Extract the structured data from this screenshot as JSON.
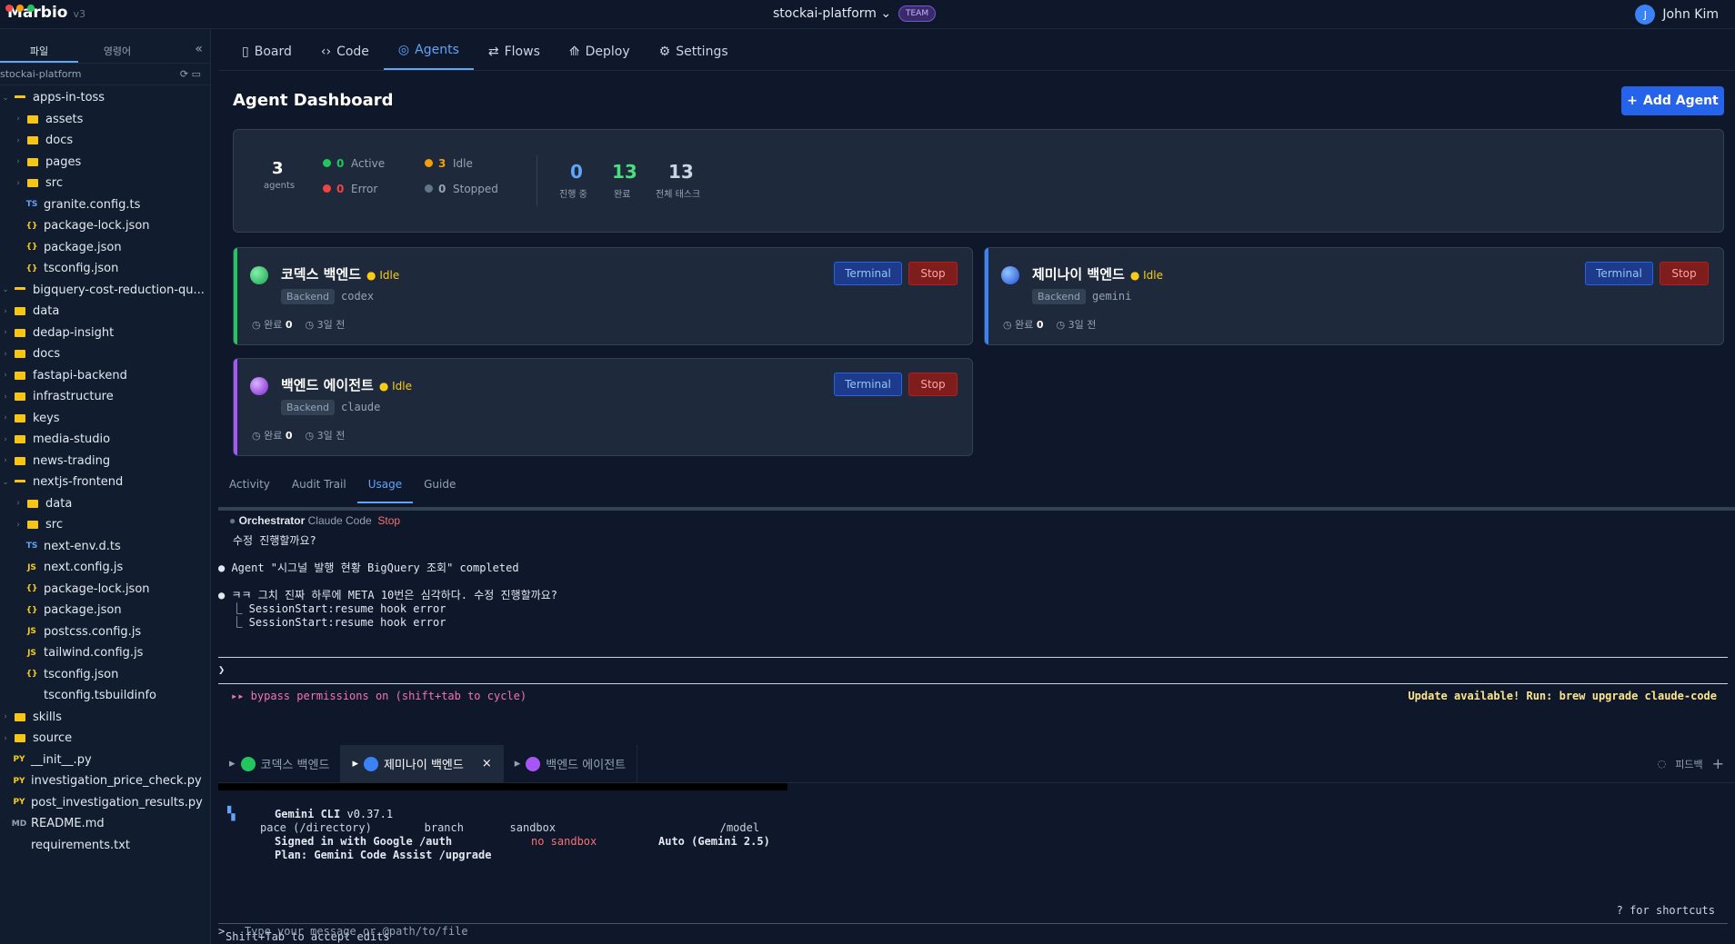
{
  "app": {
    "name": "Marbio",
    "version": "v3",
    "project": "stockai-platform",
    "team_badge": "TEAM",
    "user_initial": "J",
    "user_name": "John Kim"
  },
  "sidebar": {
    "tab_files": "파일",
    "tab_en": "영령어",
    "path": "stockai-platform",
    "tree": [
      {
        "label": "apps-in-toss",
        "type": "open"
      },
      {
        "label": "assets",
        "type": "folder",
        "indent": 1
      },
      {
        "label": "docs",
        "type": "folder",
        "indent": 1
      },
      {
        "label": "pages",
        "type": "folder",
        "indent": 1
      },
      {
        "label": "src",
        "type": "folder",
        "indent": 1
      },
      {
        "label": "granite.config.ts",
        "type": "TS",
        "indent": 1
      },
      {
        "label": "package-lock.json",
        "type": "{}",
        "indent": 1
      },
      {
        "label": "package.json",
        "type": "{}",
        "indent": 1
      },
      {
        "label": "tsconfig.json",
        "type": "{}",
        "indent": 1
      },
      {
        "label": "bigquery-cost-reduction-qu...",
        "type": "open"
      },
      {
        "label": "data",
        "type": "folder"
      },
      {
        "label": "dedap-insight",
        "type": "folder"
      },
      {
        "label": "docs",
        "type": "folder"
      },
      {
        "label": "fastapi-backend",
        "type": "folder"
      },
      {
        "label": "infrastructure",
        "type": "folder"
      },
      {
        "label": "keys",
        "type": "folder"
      },
      {
        "label": "media-studio",
        "type": "folder"
      },
      {
        "label": "news-trading",
        "type": "folder"
      },
      {
        "label": "nextjs-frontend",
        "type": "open"
      },
      {
        "label": "data",
        "type": "folder",
        "indent": 1
      },
      {
        "label": "src",
        "type": "folder",
        "indent": 1
      },
      {
        "label": "next-env.d.ts",
        "type": "TS",
        "indent": 1
      },
      {
        "label": "next.config.js",
        "type": "JS",
        "indent": 1
      },
      {
        "label": "package-lock.json",
        "type": "{}",
        "indent": 1
      },
      {
        "label": "package.json",
        "type": "{}",
        "indent": 1
      },
      {
        "label": "postcss.config.js",
        "type": "JS",
        "indent": 1
      },
      {
        "label": "tailwind.config.js",
        "type": "JS",
        "indent": 1
      },
      {
        "label": "tsconfig.json",
        "type": "{}",
        "indent": 1
      },
      {
        "label": "tsconfig.tsbuildinfo",
        "type": "",
        "indent": 1
      },
      {
        "label": "skills",
        "type": "folder"
      },
      {
        "label": "source",
        "type": "folder"
      },
      {
        "label": "__init__.py",
        "type": "PY"
      },
      {
        "label": "investigation_price_check.py",
        "type": "PY"
      },
      {
        "label": "post_investigation_results.py",
        "type": "PY"
      },
      {
        "label": "README.md",
        "type": "MD"
      },
      {
        "label": "requirements.txt",
        "type": ""
      }
    ]
  },
  "tabs": [
    "Board",
    "Code",
    "Agents",
    "Flows",
    "Deploy",
    "Settings"
  ],
  "dashboard": {
    "title": "Agent Dashboard",
    "add_button": "Add Agent",
    "stats": {
      "agents": "3",
      "agents_label": "agents",
      "active": "0",
      "active_label": "Active",
      "idle": "3",
      "idle_label": "Idle",
      "error": "0",
      "error_label": "Error",
      "stopped": "0",
      "stopped_label": "Stopped",
      "progress": "0",
      "progress_label": "진행 중",
      "done": "13",
      "done_label": "완료",
      "total": "13",
      "total_label": "전체 태스크"
    },
    "agents": [
      {
        "name": "코덱스 백엔드",
        "status": "Idle",
        "pill": "Backend",
        "model": "codex",
        "done_label": "완료",
        "done": "0",
        "time": "3일 전"
      },
      {
        "name": "제미나이 백엔드",
        "status": "Idle",
        "pill": "Backend",
        "model": "gemini",
        "done_label": "완료",
        "done": "0",
        "time": "3일 전"
      },
      {
        "name": "백엔드 에이전트",
        "status": "Idle",
        "pill": "Backend",
        "model": "claude",
        "done_label": "완료",
        "done": "0",
        "time": "3일 전"
      }
    ],
    "terminal_label": "Terminal",
    "stop_label": "Stop"
  },
  "lower_tabs": [
    "Activity",
    "Audit Trail",
    "Usage",
    "Guide"
  ],
  "orchestrator": {
    "name": "Orchestrator",
    "tool": "Claude Code",
    "stop": "Stop",
    "lines": [
      "수정 진행할까요?",
      "● Agent \"시그널 발행 현황 BigQuery 조회\" completed",
      "● ㅋㅋ 그치 진짜 하루에 META 10번은 심각하다. 수정 진행할까요?",
      "  ⎿ SessionStart:resume hook error",
      "  ⎿ SessionStart:resume hook error"
    ],
    "prompt": "❯",
    "bypass": "▸▸ bypass permissions on (shift+tab to cycle)",
    "update": "Update available! Run: brew upgrade claude-code"
  },
  "term_tabs": [
    "코덱스 백엔드",
    "제미나이 백엔드",
    "백엔드 에이전트"
  ],
  "feedback": "피드백",
  "gemini": {
    "title": "Gemini CLI",
    "version": "v0.37.1",
    "l1": "pace (/directory)        branch       sandbox                         /model",
    "l2": "Signed in with Google /auth",
    "sandbox": "no sandbox",
    "model": "Auto (Gemini 2.5)",
    "l3": "Plan: Gemini Code Assist /upgrade",
    "shortcuts": "? for shortcuts",
    "accept": "Shift+Tab to accept edits",
    "input_prompt": ">",
    "placeholder": "Type your message or @path/to/file"
  }
}
